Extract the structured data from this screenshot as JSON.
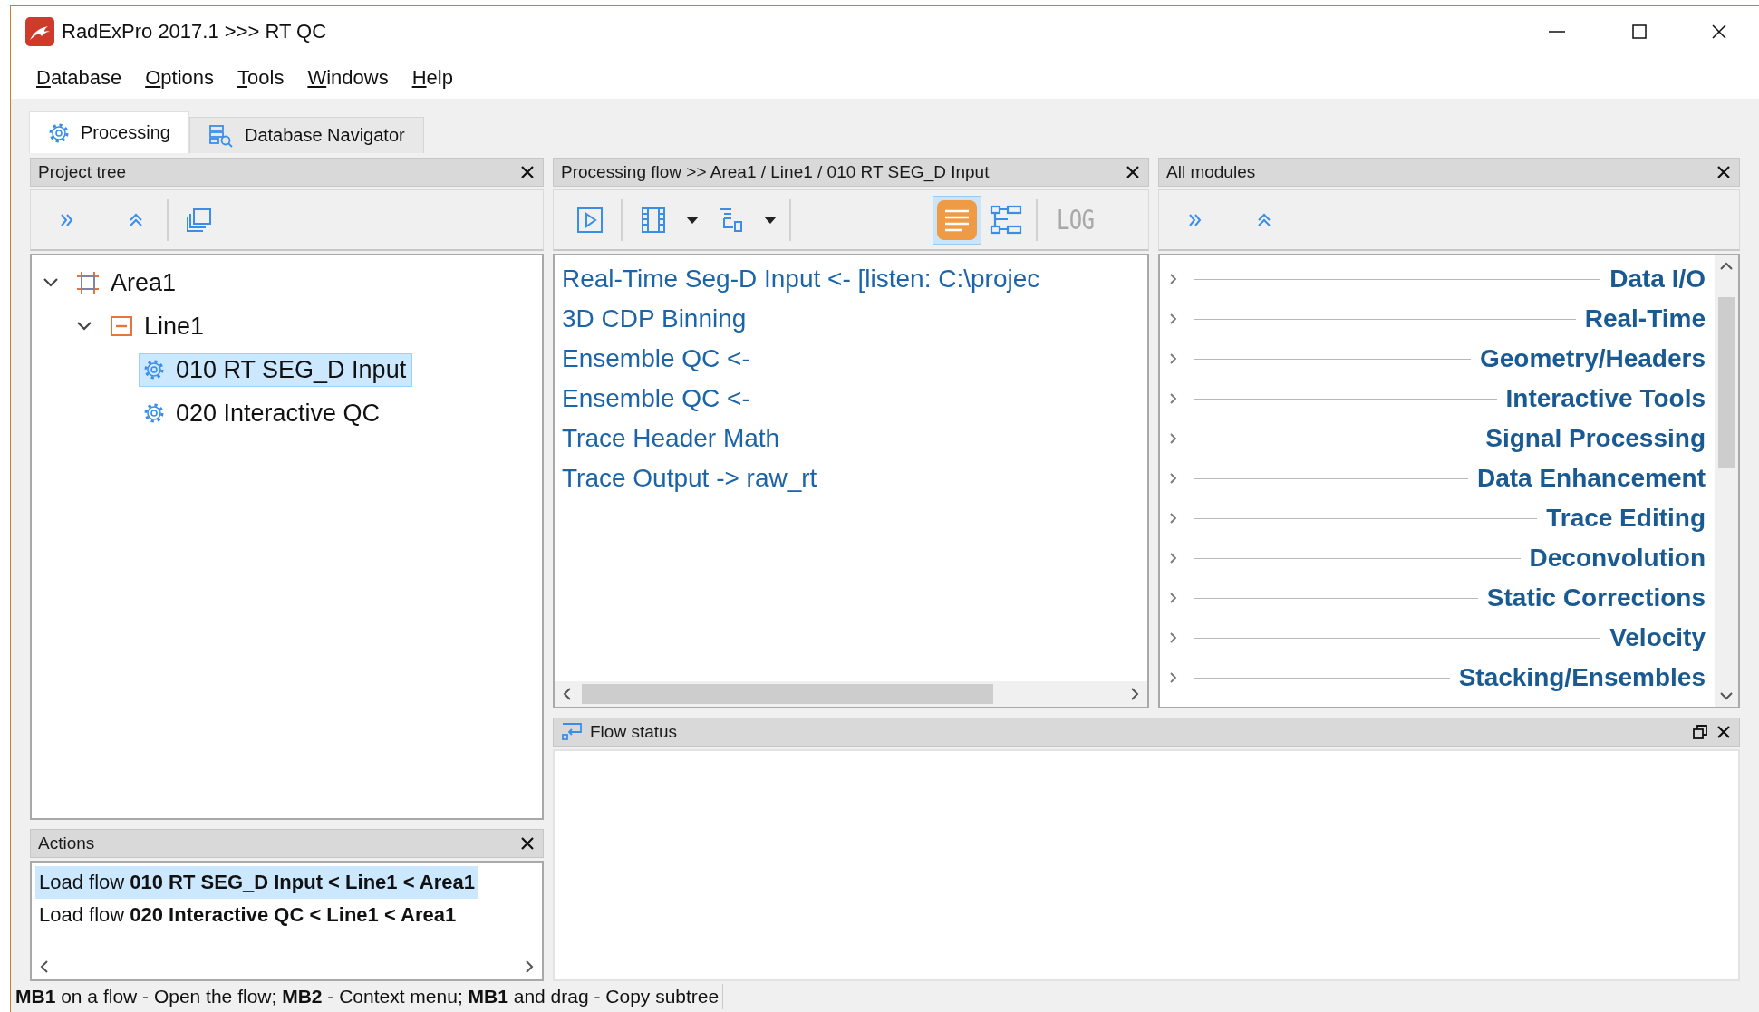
{
  "window": {
    "title": "RadExPro 2017.1 >>> RT QC"
  },
  "menu": [
    {
      "label": "Database"
    },
    {
      "label": "Options"
    },
    {
      "label": "Tools"
    },
    {
      "label": "Windows"
    },
    {
      "label": "Help"
    }
  ],
  "tabs": [
    {
      "label": "Processing",
      "selected": true
    },
    {
      "label": "Database Navigator",
      "selected": false
    }
  ],
  "project_tree": {
    "title": "Project tree",
    "items": [
      {
        "label": "Area1",
        "kind": "area",
        "selected": false,
        "expanded": true,
        "children": [
          {
            "label": "Line1",
            "kind": "line",
            "selected": false,
            "expanded": true,
            "children": [
              {
                "label": "010 RT SEG_D Input",
                "kind": "flow",
                "selected": true
              },
              {
                "label": "020 Interactive QC",
                "kind": "flow",
                "selected": false
              }
            ]
          }
        ]
      }
    ]
  },
  "processing_flow": {
    "title": "Processing flow >> Area1 / Line1 / 010 RT SEG_D Input",
    "toolbar": {
      "list_view_selected": true,
      "log_label": "LOG",
      "log_disabled": true
    },
    "modules": [
      "Real-Time Seg-D Input <- [listen: C:\\projec",
      "3D CDP Binning",
      "Ensemble QC <-",
      "Ensemble QC <-",
      "Trace Header Math",
      "Trace Output -> raw_rt"
    ]
  },
  "all_modules": {
    "title": "All modules",
    "groups": [
      {
        "label": "Data I/O",
        "expanded": false
      },
      {
        "label": "Real-Time",
        "expanded": false
      },
      {
        "label": "Geometry/Headers",
        "expanded": false
      },
      {
        "label": "Interactive Tools",
        "expanded": false
      },
      {
        "label": "Signal Processing",
        "expanded": false
      },
      {
        "label": "Data Enhancement",
        "expanded": false
      },
      {
        "label": "Trace Editing",
        "expanded": false
      },
      {
        "label": "Deconvolution",
        "expanded": false
      },
      {
        "label": "Static Corrections",
        "expanded": false
      },
      {
        "label": "Velocity",
        "expanded": false
      },
      {
        "label": "Stacking/Ensembles",
        "expanded": false
      }
    ]
  },
  "flow_status": {
    "title": "Flow status"
  },
  "actions": {
    "title": "Actions",
    "items": [
      {
        "text": "Load flow **010 RT SEG_D Input < Line1 < Area1**",
        "selected": true
      },
      {
        "text": "Load flow **020 Interactive QC < Line1 < Area1**",
        "selected": false
      }
    ]
  },
  "status_bar": "**MB1** on a flow - Open the flow; **MB2** - Context menu; **MB1** and drag - Copy subtree"
}
